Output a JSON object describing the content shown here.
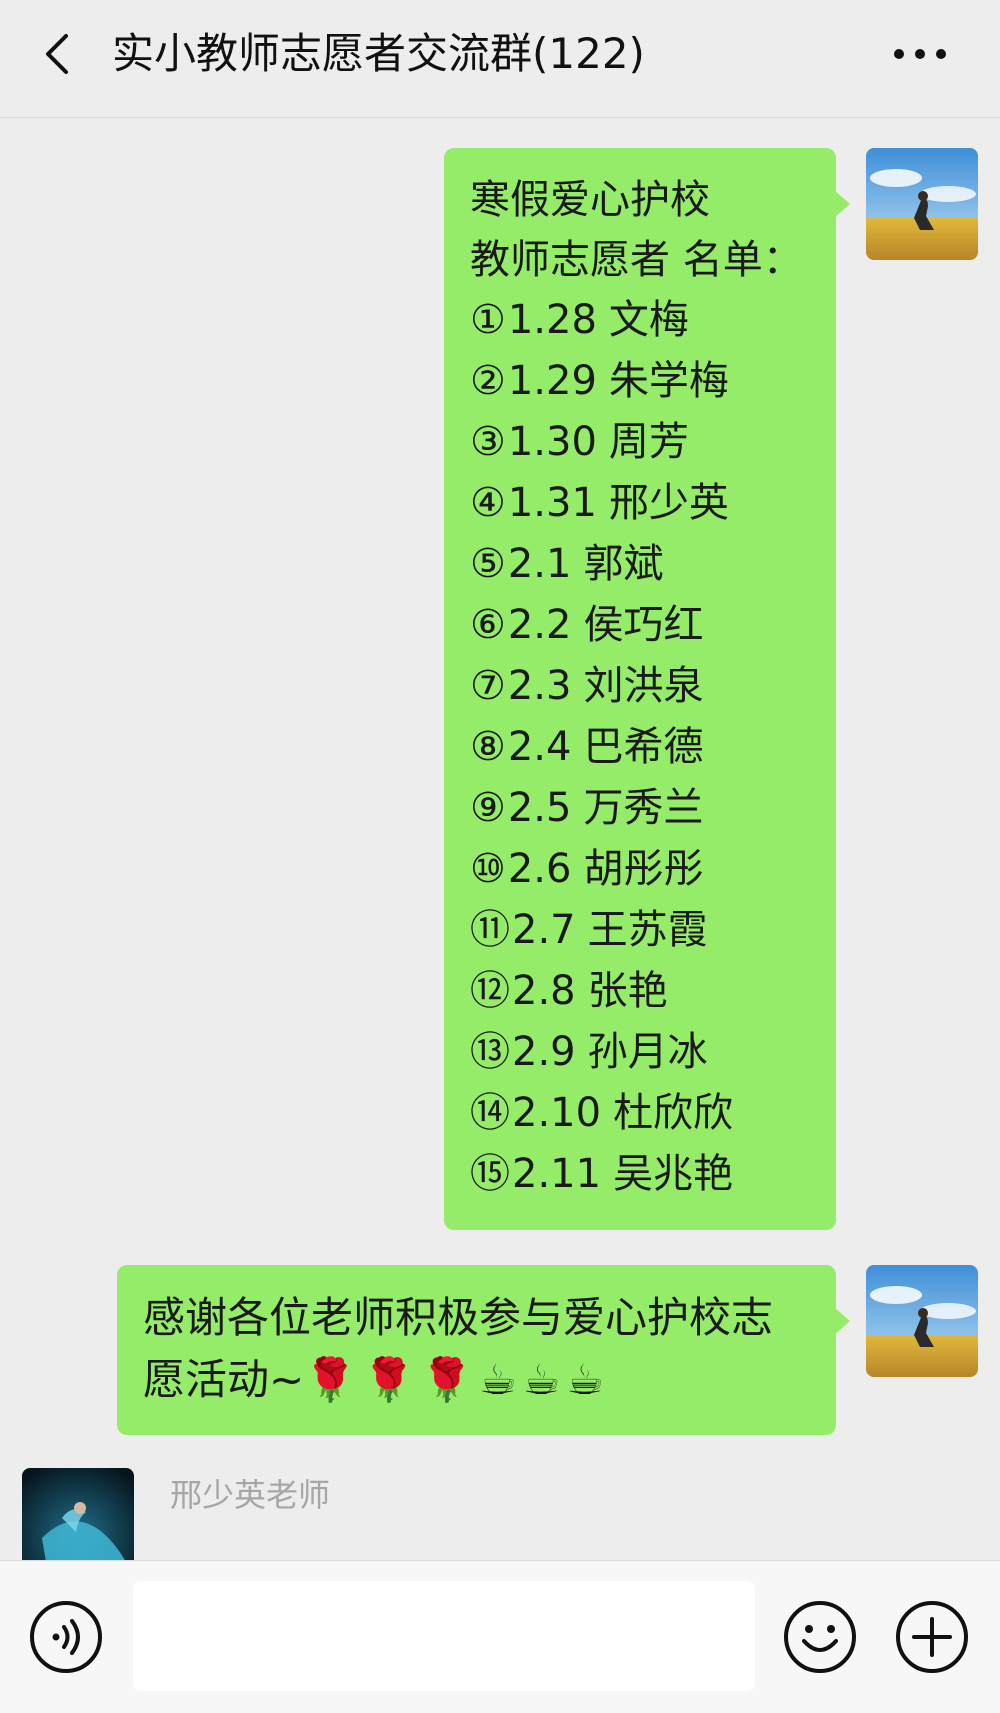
{
  "header": {
    "back_icon": "chevron-left-icon",
    "title": "实小教师志愿者交流群(122)",
    "more_icon": "ellipsis-icon"
  },
  "messages": [
    {
      "side": "right",
      "avatar": "landscape-avatar",
      "title_lines": [
        "寒假爱心护校",
        "教师志愿者 名单："
      ],
      "roster": [
        {
          "num": "①",
          "date": "1.28",
          "name": "文梅"
        },
        {
          "num": "②",
          "date": "1.29",
          "name": "朱学梅"
        },
        {
          "num": "③",
          "date": "1.30",
          "name": "周芳"
        },
        {
          "num": "④",
          "date": "1.31",
          "name": "邢少英"
        },
        {
          "num": "⑤",
          "date": "2.1",
          "name": "郭斌"
        },
        {
          "num": "⑥",
          "date": "2.2",
          "name": "侯巧红"
        },
        {
          "num": "⑦",
          "date": "2.3",
          "name": "刘洪泉"
        },
        {
          "num": "⑧",
          "date": "2.4",
          "name": "巴希德"
        },
        {
          "num": "⑨",
          "date": "2.5",
          "name": "万秀兰"
        },
        {
          "num": "⑩",
          "date": "2.6",
          "name": "胡彤彤"
        },
        {
          "num": "⑪",
          "date": "2.7",
          "name": "王苏霞"
        },
        {
          "num": "⑫",
          "date": "2.8",
          "name": "张艳"
        },
        {
          "num": "⑬",
          "date": "2.9",
          "name": "孙月冰"
        },
        {
          "num": "⑭",
          "date": "2.10",
          "name": "杜欣欣"
        },
        {
          "num": "⑮",
          "date": "2.11",
          "name": "吴兆艳"
        }
      ]
    },
    {
      "side": "right",
      "avatar": "landscape-avatar",
      "text": "感谢各位老师积极参与爱心护校志愿活动~",
      "emojis": "🌹🌹🌹☕☕☕"
    },
    {
      "side": "left",
      "avatar": "dancer-avatar",
      "sender": "邢少英老师"
    }
  ],
  "input_bar": {
    "voice_icon": "voice-icon",
    "input_value": "",
    "emoji_icon": "smiley-icon",
    "plus_icon": "plus-icon"
  },
  "colors": {
    "background": "#ededed",
    "bubble": "#95ec69",
    "sender_name": "#a6a6a6"
  }
}
